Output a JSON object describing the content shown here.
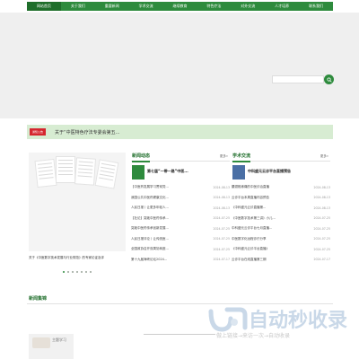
{
  "nav": {
    "items": [
      {
        "label": "网站首页",
        "active": true
      },
      {
        "label": "关于我们",
        "active": false
      },
      {
        "label": "重要新闻",
        "active": false
      },
      {
        "label": "学术交流",
        "active": false
      },
      {
        "label": "继续教育",
        "active": false
      },
      {
        "label": "特色疗法",
        "active": false
      },
      {
        "label": "对外交流",
        "active": false
      },
      {
        "label": "人才培养",
        "active": false
      },
      {
        "label": "联系我们",
        "active": false
      }
    ]
  },
  "search": {
    "placeholder": "",
    "button_icon": "search-icon"
  },
  "notice": {
    "tag": "通知公告",
    "text": "关于“中医特色疗法专委会第五..."
  },
  "slider": {
    "caption": "关于《中医数字技术发展与行业规范》的专家论证及评",
    "dot_count": 7,
    "active_dot": 0
  },
  "news": {
    "title": "新闻动态",
    "more": "更多»",
    "featured": "第七届“一带一路”中医...",
    "items": [
      {
        "title": "【中医药发展学习贯彻党...",
        "date": "2024-08-13"
      },
      {
        "title": "我国公共中医药健康文化...",
        "date": "2024-08-13"
      },
      {
        "title": "人民日报丨让更多年轻人...",
        "date": "2024-08-13"
      },
      {
        "title": "【社论】突破中医药传承...",
        "date": "2024-07-25"
      },
      {
        "title": "突破中医药传承创新发展...",
        "date": "2024-07-25"
      },
      {
        "title": "人民日报评论丨让传统医...",
        "date": "2024-07-25"
      },
      {
        "title": "全国政协召开双周协商座...",
        "date": "2024-07-25"
      },
      {
        "title": "第十九届海峡论坛2024...",
        "date": "2024-07-17"
      }
    ]
  },
  "academic": {
    "title": "学术交流",
    "more": "更多»",
    "featured": "中科盛元云诊平台直播预告",
    "items": [
      {
        "title": "腰颈椎疼痛的中医诊治直播",
        "date": "2024-08-13"
      },
      {
        "title": "云诊平台本周直播内容预告",
        "date": "2024-08-13"
      },
      {
        "title": "《中科盛元云诊直播第...",
        "date": "2024-08-13"
      },
      {
        "title": "《中医数字技术第三讲》小儿...",
        "date": "2024-07-25"
      },
      {
        "title": "中科盛元云诊平台七月直播...",
        "date": "2024-07-25"
      },
      {
        "title": "中医数字化远程诊疗分享",
        "date": "2024-07-25"
      },
      {
        "title": "《中科盛元云诊平台直播》",
        "date": "2024-07-25"
      },
      {
        "title": "云诊平台在线直播第三期",
        "date": "2024-07-17"
      }
    ]
  },
  "gallery": {
    "title": "新闻集锦",
    "image_text": "主题学习"
  },
  "watermark": {
    "name": "自动秒收录",
    "sub": "做上链接→来访一次→自动收录"
  },
  "colors": {
    "brand_green": "#2e8b3d",
    "notice_bg": "#d7ecd2",
    "tag_red": "#d5272f"
  }
}
